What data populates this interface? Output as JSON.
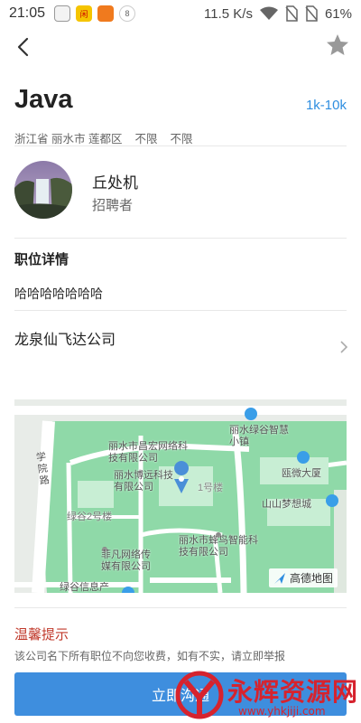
{
  "status_bar": {
    "time": "21:05",
    "speed": "11.5 K/s",
    "battery": "61%"
  },
  "job": {
    "title": "Java",
    "salary": "1k-10k",
    "location": "浙江省 丽水市 莲都区",
    "experience": "不限",
    "education": "不限"
  },
  "recruiter": {
    "name": "丘处机",
    "role": "招聘者"
  },
  "details": {
    "section_title": "职位详情",
    "description": "哈哈哈哈哈哈哈"
  },
  "company": {
    "name": "龙泉仙飞达公司"
  },
  "map": {
    "labels": [
      "学院路",
      "丽水市昌宏网络科技有限公司",
      "丽水博远科技有限公司",
      "1号楼",
      "丽水绿谷智慧小镇",
      "瓯微大厦",
      "山山梦想城",
      "绿谷2号楼",
      "丽水市蜂鸟智能科技有限公司",
      "菲凡网络传媒有限公司",
      "绿谷信息产"
    ],
    "provider": "高德地图"
  },
  "notice": {
    "title": "温馨提示",
    "text": "该公司名下所有职位不向您收费，如有不实，请立即举报"
  },
  "apply_button": {
    "label": "立即沟通"
  },
  "watermark": {
    "text": "永辉资源网",
    "url": "www.yhkjiji.com"
  },
  "colors": {
    "accent": "#3e8ede",
    "salary": "#2f8ee0",
    "warning": "#c0392b",
    "map_green": "#8fd9a8",
    "map_road": "#ffffff"
  }
}
